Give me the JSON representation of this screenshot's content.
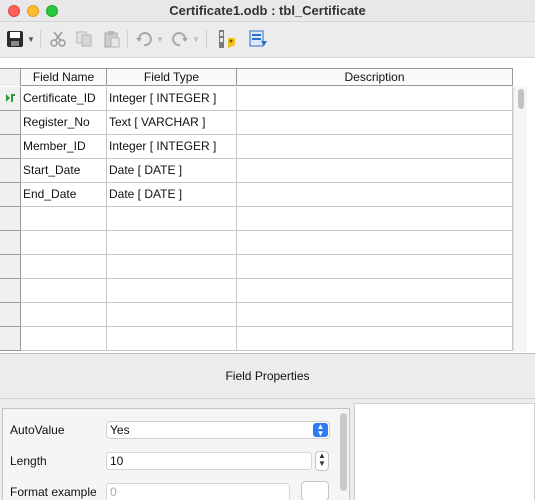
{
  "window": {
    "title": "Certificate1.odb : tbl_Certificate"
  },
  "toolbar": {
    "icons": [
      "save-icon",
      "cut-icon",
      "copy-icon",
      "paste-icon",
      "undo-icon",
      "redo-icon",
      "primary-key-icon",
      "index-design-icon"
    ]
  },
  "table": {
    "columns": [
      "Field Name",
      "Field Type",
      "Description"
    ],
    "rows": [
      {
        "name": "Certificate_ID",
        "type": "Integer [ INTEGER ]",
        "description": ""
      },
      {
        "name": "Register_No",
        "type": "Text [ VARCHAR ]",
        "description": ""
      },
      {
        "name": "Member_ID",
        "type": "Integer [ INTEGER ]",
        "description": ""
      },
      {
        "name": "Start_Date",
        "type": "Date [ DATE ]",
        "description": ""
      },
      {
        "name": "End_Date",
        "type": "Date [ DATE ]",
        "description": ""
      },
      {
        "name": "",
        "type": "",
        "description": ""
      },
      {
        "name": "",
        "type": "",
        "description": ""
      },
      {
        "name": "",
        "type": "",
        "description": ""
      },
      {
        "name": "",
        "type": "",
        "description": ""
      },
      {
        "name": "",
        "type": "",
        "description": ""
      },
      {
        "name": "",
        "type": "",
        "description": ""
      }
    ],
    "primary_key_row": 0
  },
  "field_properties": {
    "title": "Field Properties",
    "autovalue": {
      "label": "AutoValue",
      "value": "Yes"
    },
    "length": {
      "label": "Length",
      "value": "10"
    },
    "format_example": {
      "label": "Format example",
      "value": "0"
    }
  },
  "colors": {
    "close": "#fe5f57",
    "minimize": "#febc2e",
    "maximize": "#28c840",
    "select_accent": "#2f7af6",
    "primary_key_marker": "#2e9a3e"
  }
}
